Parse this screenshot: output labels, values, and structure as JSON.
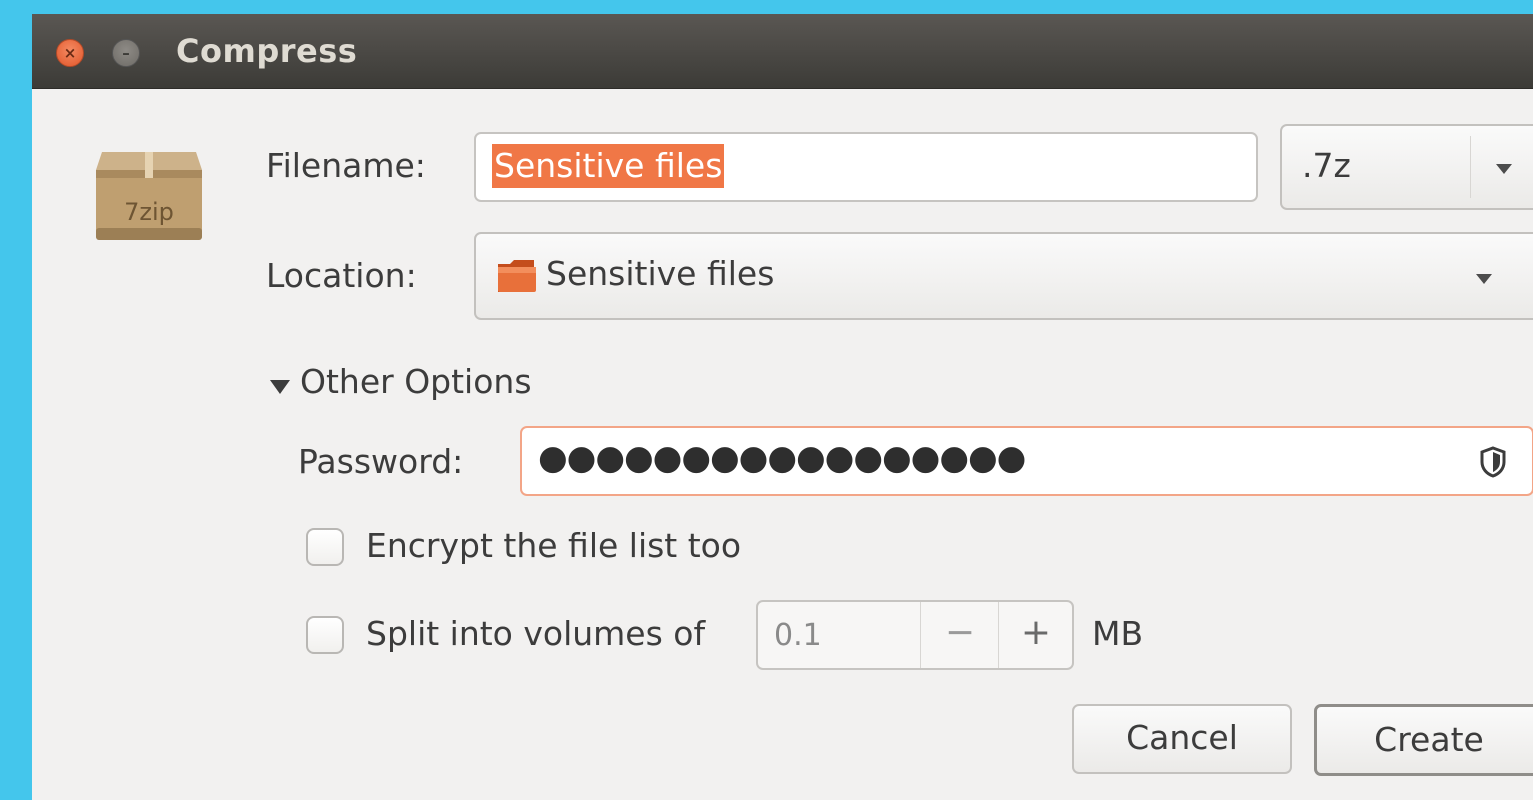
{
  "window": {
    "title": "Compress"
  },
  "form": {
    "filename_label": "Filename:",
    "filename_value": "Sensitive files",
    "extension": ".7z",
    "location_label": "Location:",
    "location_value": "Sensitive files",
    "other_options_label": "Other Options",
    "password_label": "Password:",
    "password_value": "●●●●●●●●●●●●●●●●●",
    "encrypt_label": "Encrypt the file list too",
    "encrypt_checked": false,
    "split_label": "Split into volumes of",
    "split_checked": false,
    "split_value": "0.1",
    "split_unit": "MB"
  },
  "icon": {
    "package_label": "7zip"
  },
  "buttons": {
    "cancel": "Cancel",
    "create": "Create"
  },
  "colors": {
    "accent": "#f07746",
    "background": "#44c6ec",
    "titlebar": "#3c3b37"
  }
}
